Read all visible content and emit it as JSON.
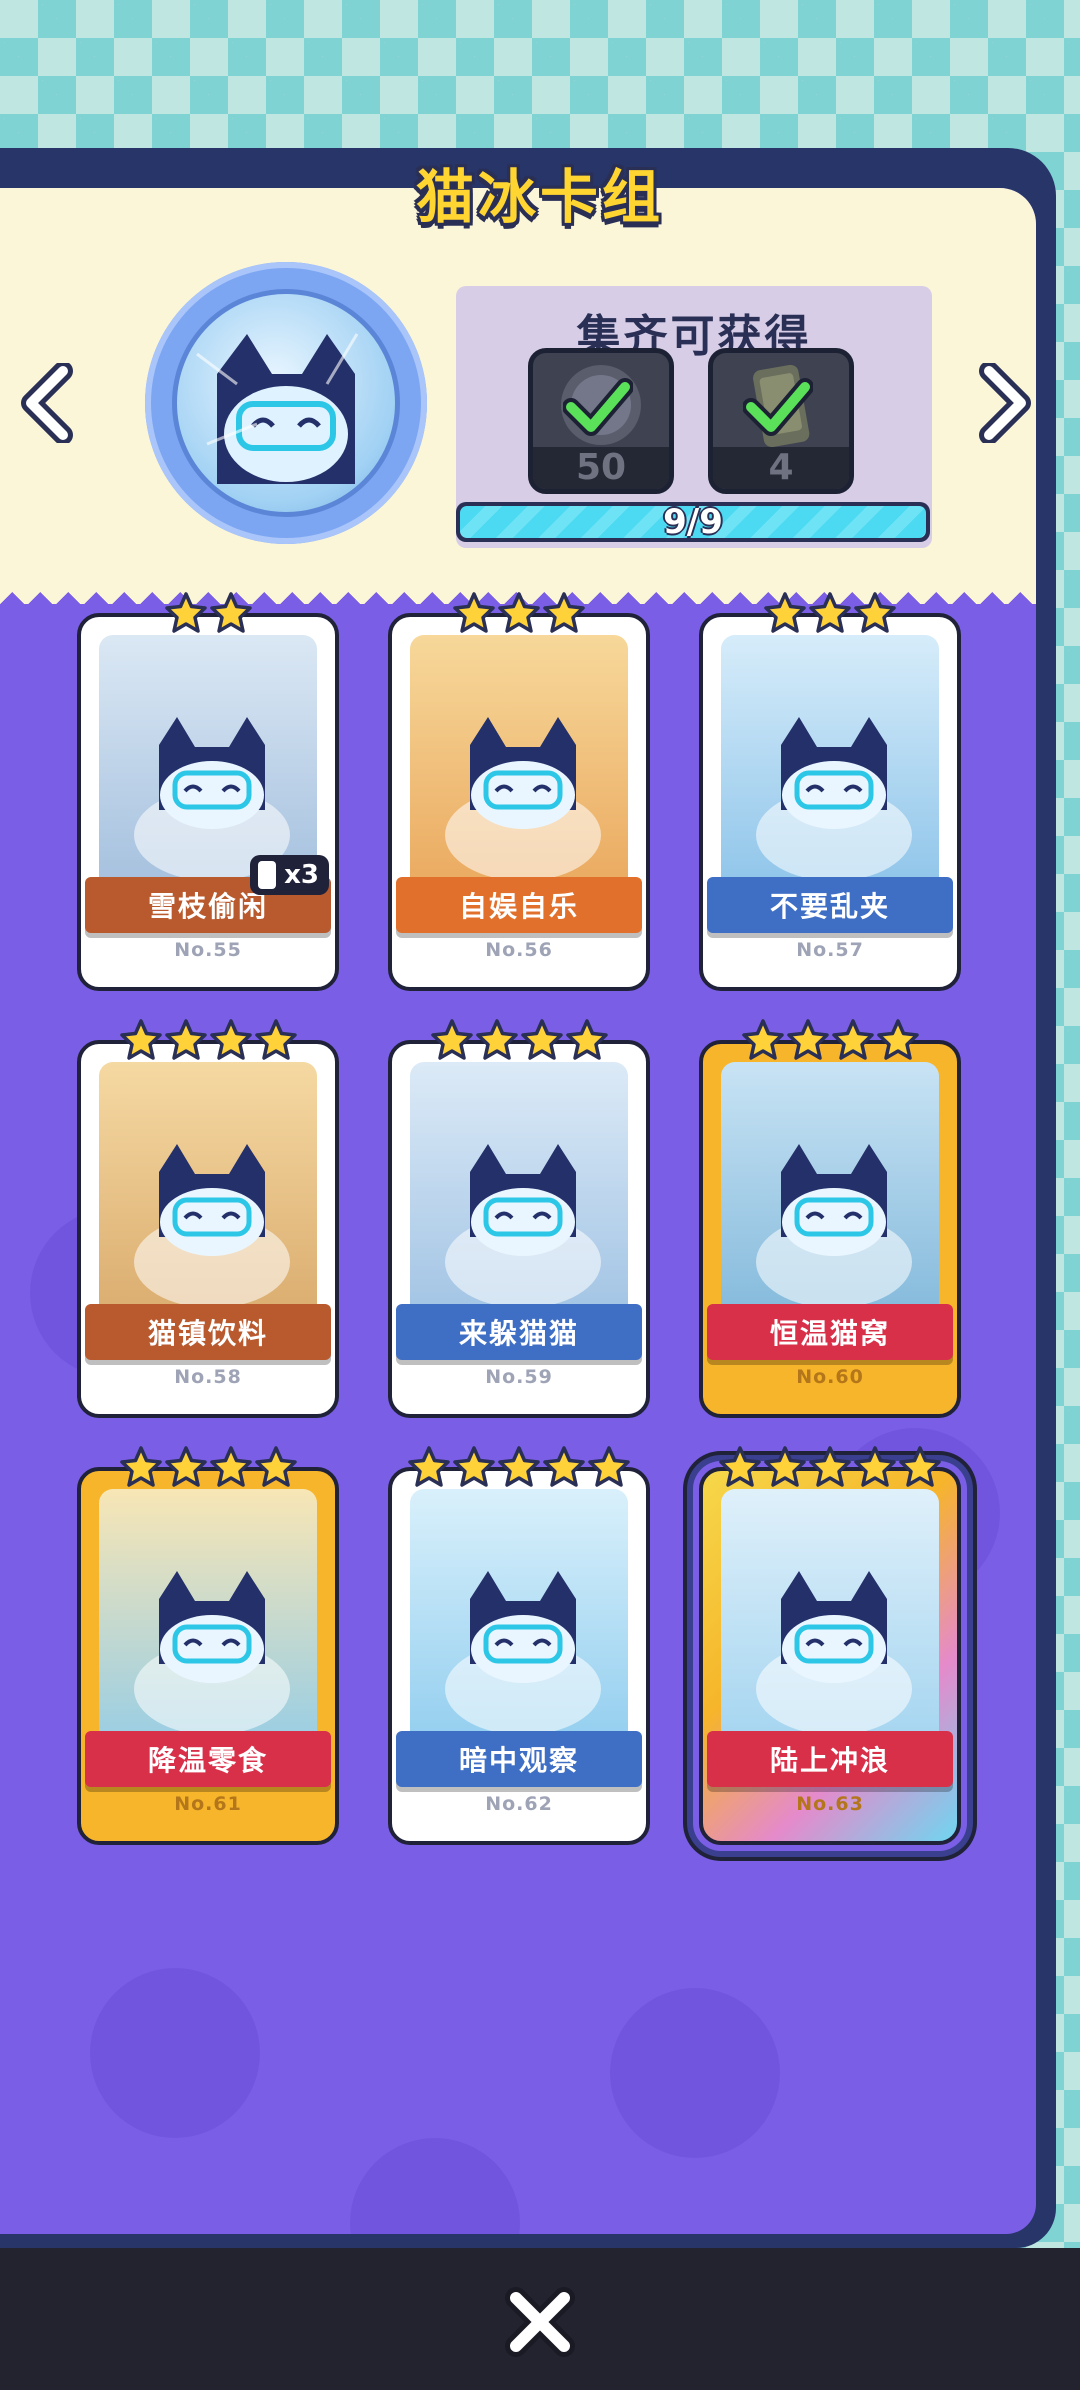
{
  "title": "猫冰卡组",
  "nav": {
    "prev_icon": "chevron-left-icon",
    "next_icon": "chevron-right-icon"
  },
  "badge": {
    "icon": "cat-ice-badge-icon"
  },
  "rewards": {
    "title": "集齐可获得",
    "items": [
      {
        "icon": "cat-token-icon",
        "count": "50",
        "collected": true
      },
      {
        "icon": "phone-card-icon",
        "count": "4",
        "collected": true
      }
    ]
  },
  "progress": {
    "text": "9/9",
    "collected": 9,
    "total": 9
  },
  "cards": [
    {
      "name": "雪枝偷闲",
      "number": "No.55",
      "stars": 2,
      "duplicate": "x3",
      "ribbon": "#b85a2e",
      "frame": "#ffffff",
      "art": [
        "#dbe8f4",
        "#9fbcdc"
      ]
    },
    {
      "name": "自娱自乐",
      "number": "No.56",
      "stars": 3,
      "ribbon": "#e0702c",
      "frame": "#ffffff",
      "art": [
        "#f7d89a",
        "#e9a55a"
      ]
    },
    {
      "name": "不要乱夹",
      "number": "No.57",
      "stars": 3,
      "ribbon": "#3f6fc5",
      "frame": "#ffffff",
      "art": [
        "#d6ecfa",
        "#88c1e8"
      ]
    },
    {
      "name": "猫镇饮料",
      "number": "No.58",
      "stars": 4,
      "ribbon": "#b85a2e",
      "frame": "#ffffff",
      "art": [
        "#f5d9a2",
        "#d8a86a"
      ]
    },
    {
      "name": "来躲猫猫",
      "number": "No.59",
      "stars": 4,
      "ribbon": "#3f6fc5",
      "frame": "#ffffff",
      "art": [
        "#dceaf7",
        "#9cc0e2"
      ]
    },
    {
      "name": "恒温猫窝",
      "number": "No.60",
      "stars": 4,
      "ribbon": "#d9304a",
      "frame": "#f6b52a",
      "art": [
        "#c8e3f4",
        "#7eb6d9"
      ]
    },
    {
      "name": "降温零食",
      "number": "No.61",
      "stars": 4,
      "ribbon": "#d9304a",
      "frame": "#f6b52a",
      "art": [
        "#f8e6b5",
        "#8fcbe9"
      ]
    },
    {
      "name": "暗中观察",
      "number": "No.62",
      "stars": 5,
      "ribbon": "#3f6fc5",
      "frame": "#ffffff",
      "art": [
        "#d9f0fb",
        "#8ccbee"
      ]
    },
    {
      "name": "陆上冲浪",
      "number": "No.63",
      "stars": 5,
      "ribbon": "#d9304a",
      "frame": "#f6b52a",
      "art": [
        "#dff0fa",
        "#9fd2ef"
      ],
      "special": true
    }
  ],
  "close": {
    "icon": "close-icon"
  }
}
